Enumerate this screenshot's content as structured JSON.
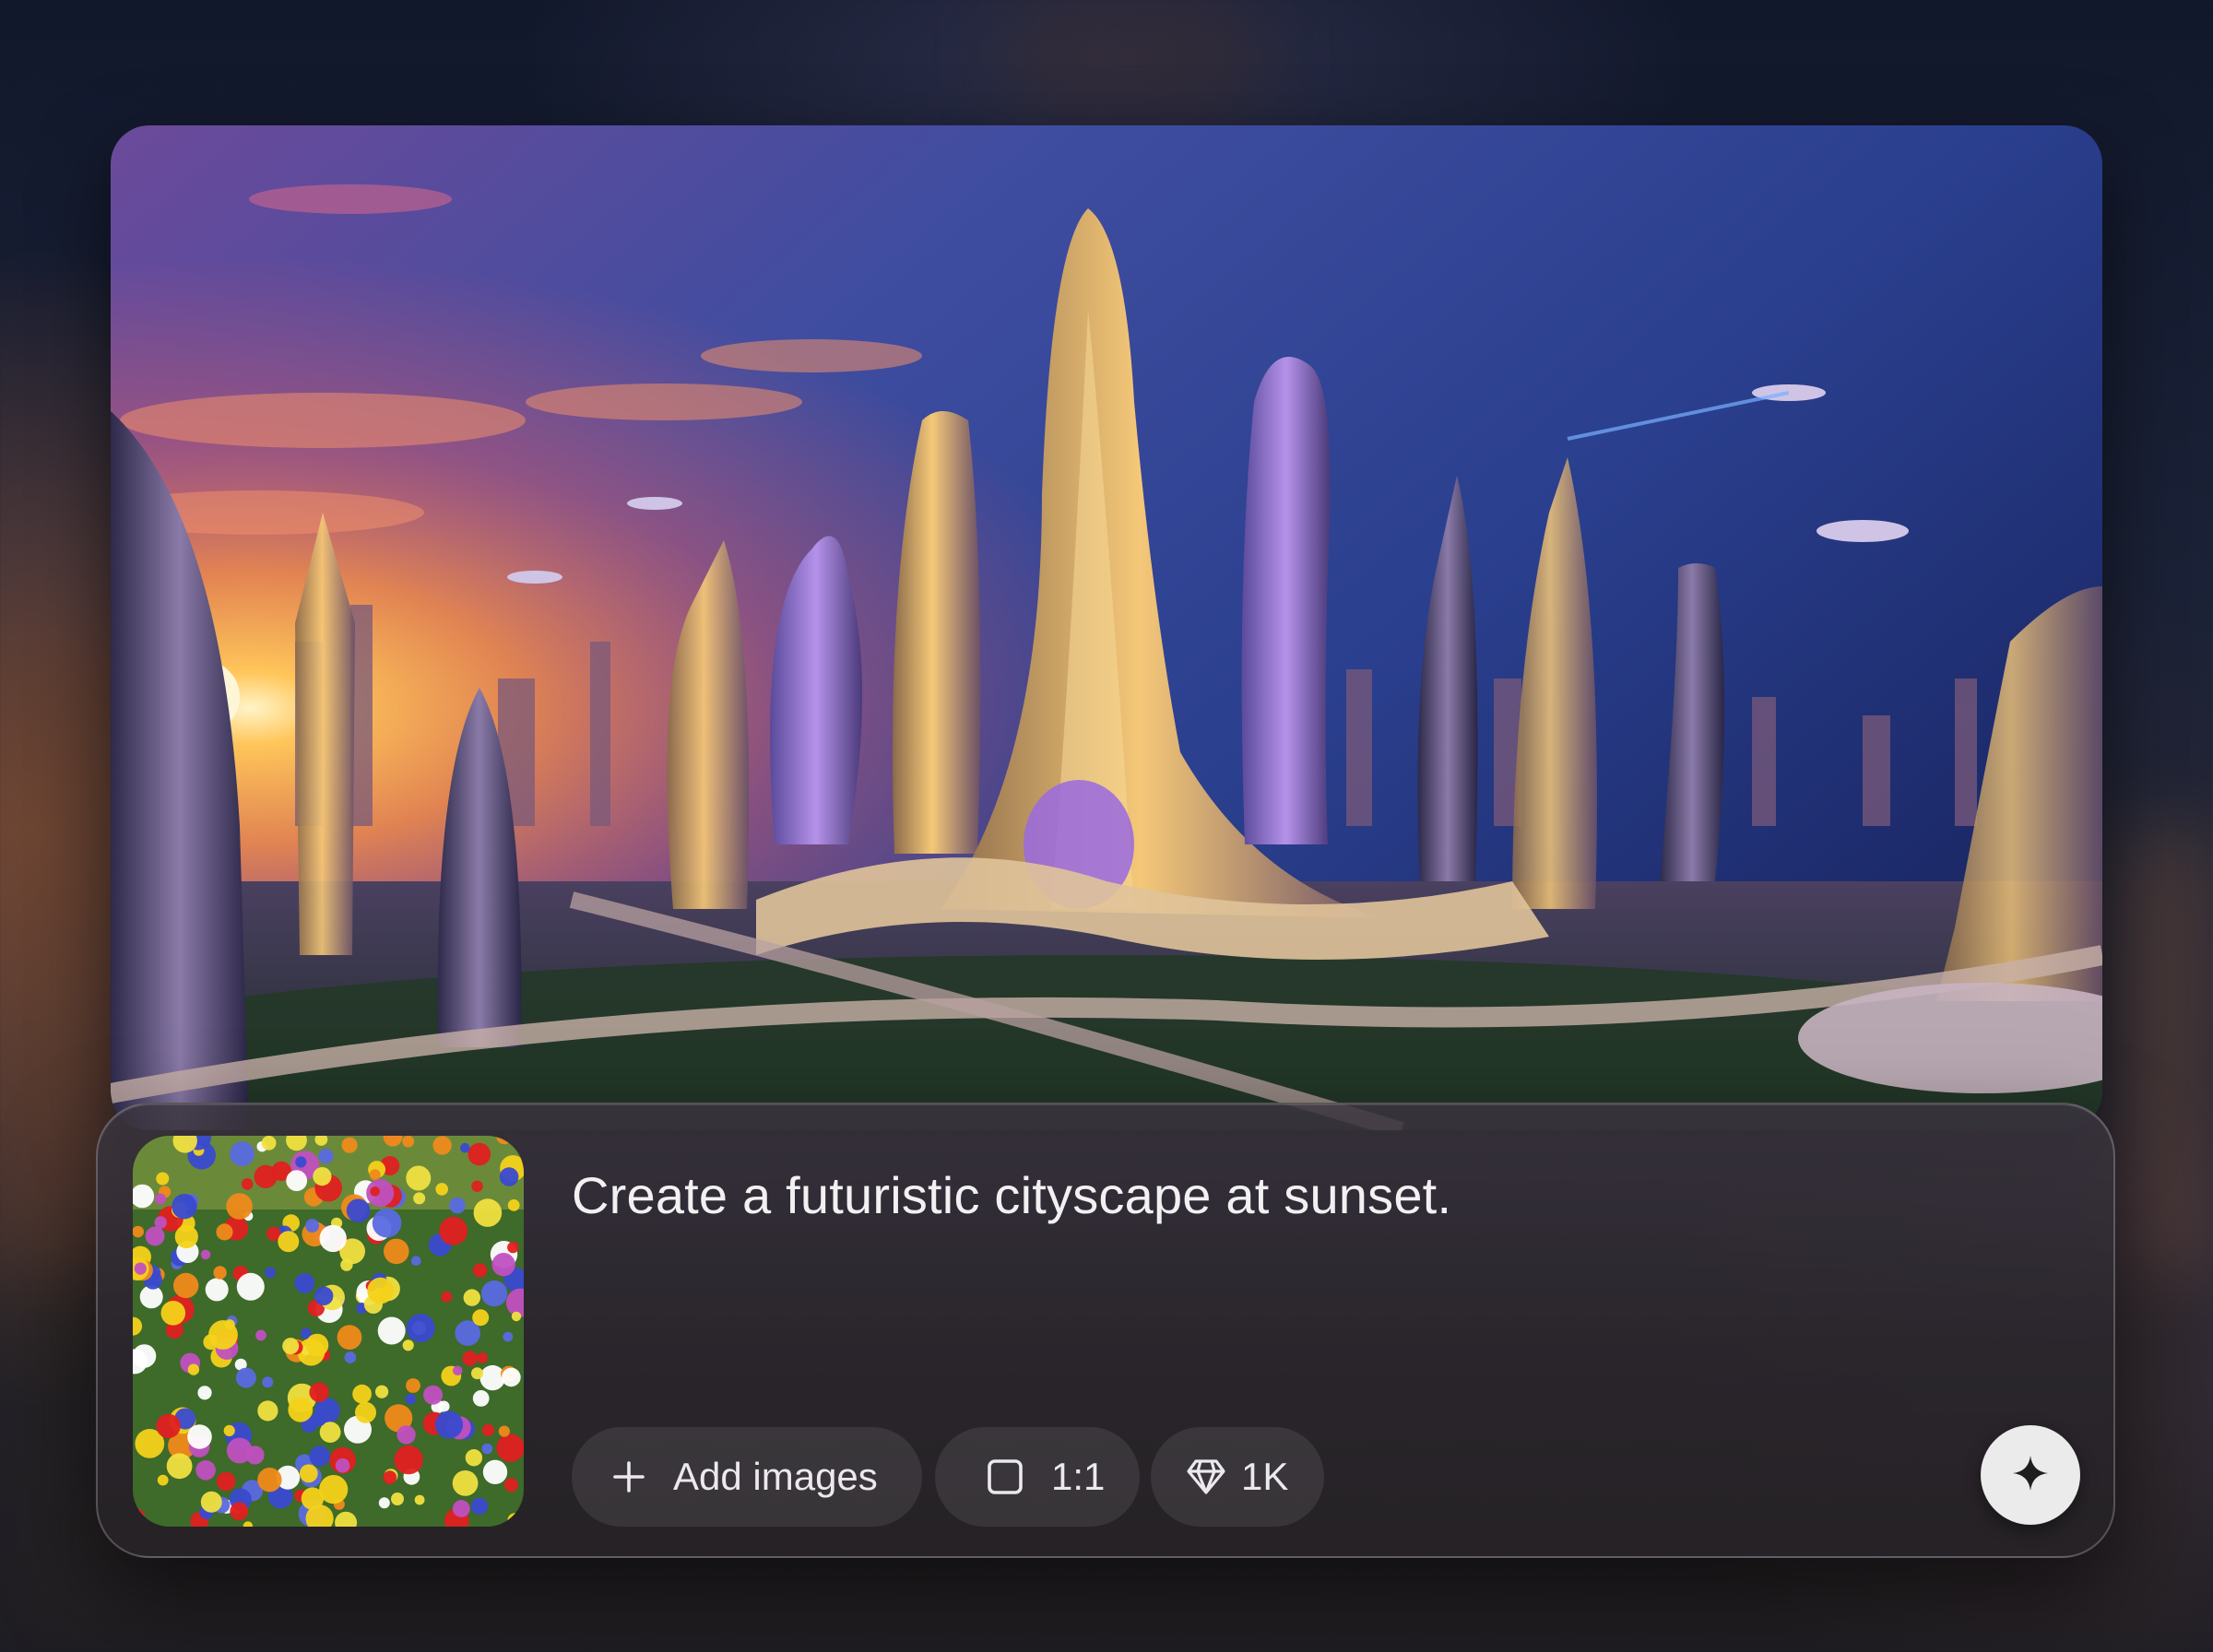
{
  "hero": {
    "description_icon": "futuristic-cityscape-image"
  },
  "prompt": {
    "text": "Create a futuristic cityscape at sunset.",
    "reference_image_icon": "flower-field-thumbnail"
  },
  "toolbar": {
    "add_images_label": "Add images",
    "add_images_icon": "plus-icon",
    "aspect_ratio_label": "1:1",
    "aspect_ratio_icon": "square-icon",
    "quality_label": "1K",
    "quality_icon": "diamond-icon",
    "generate_icon": "sparkle-icon"
  },
  "colors": {
    "panel_bg": "#2d2930",
    "chip_bg": "#3a363c",
    "button_bg": "#ebebeb",
    "text": "#f3f0f2"
  }
}
